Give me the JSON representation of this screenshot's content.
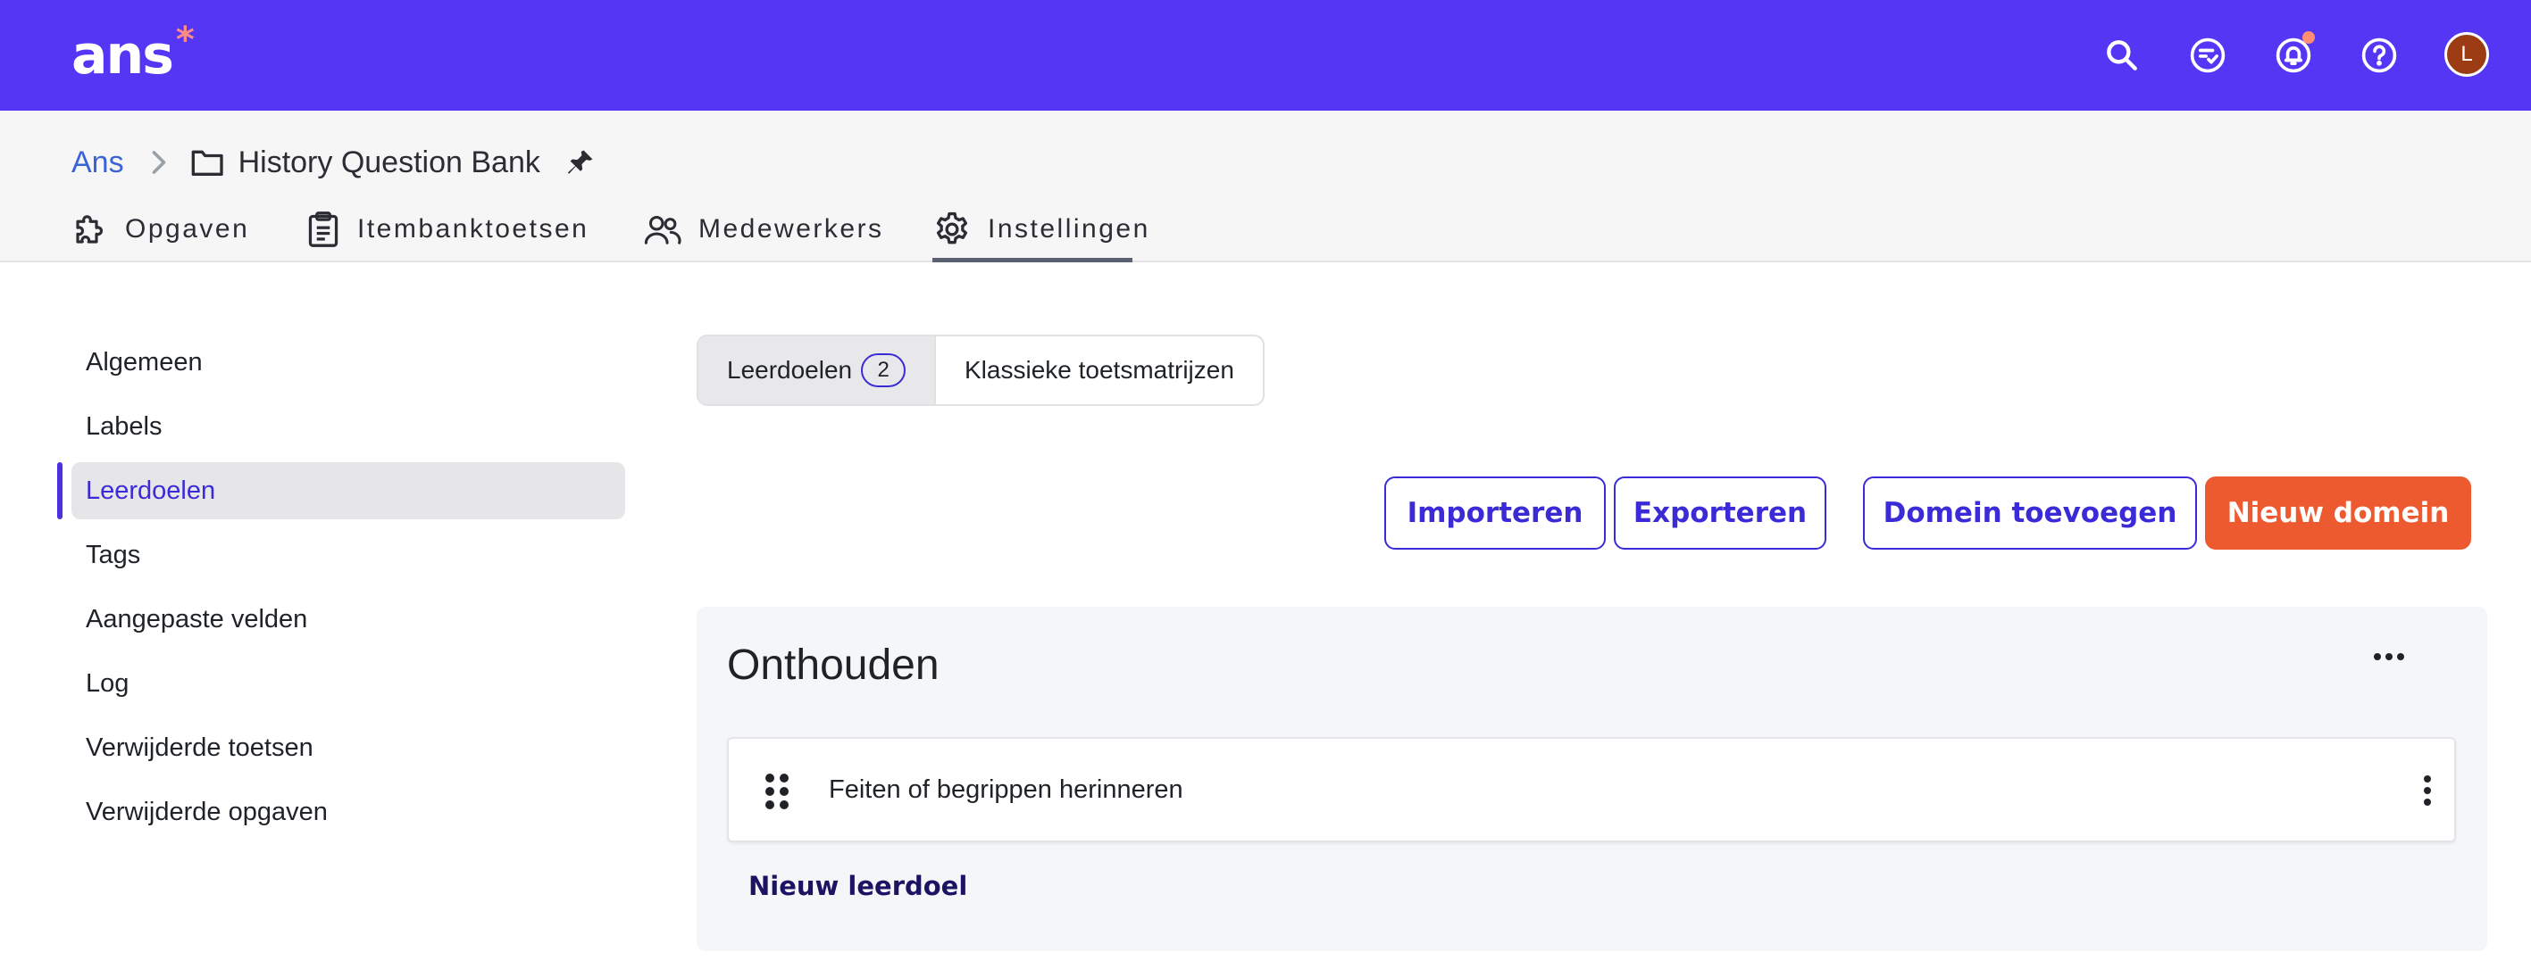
{
  "app": {
    "logo_text": "ans",
    "logo_star": "*",
    "brand_color": "#5536f5",
    "accent_color": "#3b2bd6",
    "primary_button_color": "#ee5a2f",
    "topbar_icons": [
      "search-icon",
      "checklist-icon",
      "bell-icon",
      "help-icon"
    ],
    "avatar_initial": "L"
  },
  "breadcrumb": {
    "root": "Ans",
    "separator_icon": "chevron-right-icon",
    "folder_icon": "folder-icon",
    "title": "History Question Bank",
    "pin_icon": "pin-icon"
  },
  "tabs": [
    {
      "label": "Opgaven",
      "icon": "puzzle-icon",
      "active": false
    },
    {
      "label": "Itembanktoetsen",
      "icon": "clipboard-icon",
      "active": false
    },
    {
      "label": "Medewerkers",
      "icon": "users-icon",
      "active": false
    },
    {
      "label": "Instellingen",
      "icon": "gear-icon",
      "active": true
    }
  ],
  "sidebar": {
    "items": [
      {
        "label": "Algemeen",
        "active": false
      },
      {
        "label": "Labels",
        "active": false
      },
      {
        "label": "Leerdoelen",
        "active": true
      },
      {
        "label": "Tags",
        "active": false
      },
      {
        "label": "Aangepaste velden",
        "active": false
      },
      {
        "label": "Log",
        "active": false
      },
      {
        "label": "Verwijderde toetsen",
        "active": false
      },
      {
        "label": "Verwijderde opgaven",
        "active": false
      }
    ]
  },
  "segmented": {
    "items": [
      {
        "label": "Leerdoelen",
        "count": "2",
        "active": true
      },
      {
        "label": "Klassieke toetsmatrijzen",
        "active": false
      }
    ]
  },
  "actions": {
    "import": "Importeren",
    "export": "Exporteren",
    "add_domain": "Domein toevoegen",
    "new_domain": "Nieuw domein"
  },
  "domain": {
    "title": "Onthouden",
    "goals": [
      {
        "label": "Feiten of begrippen herinneren"
      }
    ],
    "new_goal": "Nieuw leerdoel"
  }
}
